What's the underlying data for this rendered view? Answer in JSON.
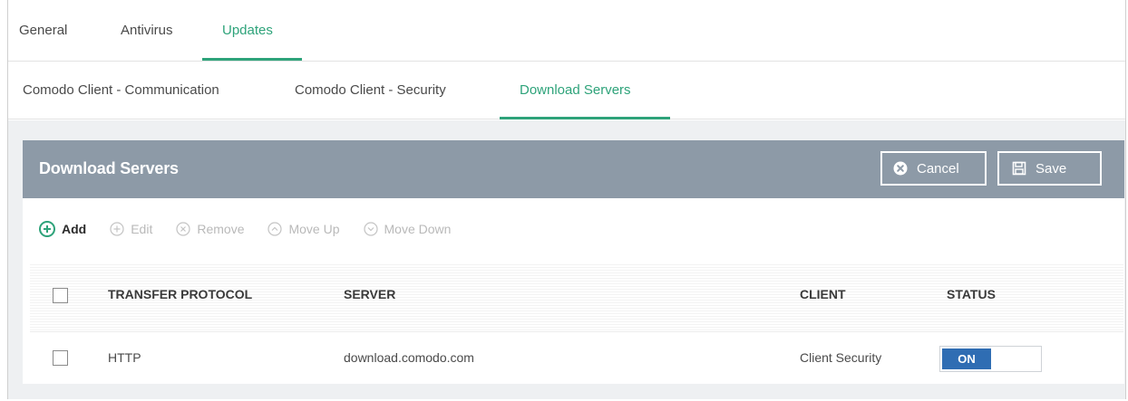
{
  "tabs_primary": [
    {
      "label": "General",
      "active": false
    },
    {
      "label": "Antivirus",
      "active": false
    },
    {
      "label": "Updates",
      "active": true
    }
  ],
  "tabs_secondary": [
    {
      "label": "Comodo Client - Communication",
      "active": false
    },
    {
      "label": "Comodo Client - Security",
      "active": false
    },
    {
      "label": "Download Servers",
      "active": true
    }
  ],
  "panel": {
    "title": "Download Servers",
    "cancel_label": "Cancel",
    "save_label": "Save",
    "cancel_icon": "close-circle-icon",
    "save_icon": "floppy-disk-icon"
  },
  "toolbar": {
    "items": [
      {
        "label": "Add",
        "icon": "plus-circle-icon",
        "enabled": true
      },
      {
        "label": "Edit",
        "icon": "plus-circle-icon",
        "enabled": false
      },
      {
        "label": "Remove",
        "icon": "x-circle-icon",
        "enabled": false
      },
      {
        "label": "Move Up",
        "icon": "chevron-up-circle-icon",
        "enabled": false
      },
      {
        "label": "Move Down",
        "icon": "chevron-down-circle-icon",
        "enabled": false
      }
    ]
  },
  "table": {
    "columns": [
      "TRANSFER PROTOCOL",
      "SERVER",
      "CLIENT",
      "STATUS"
    ],
    "rows": [
      {
        "protocol": "HTTP",
        "server": "download.comodo.com",
        "client": "Client Security",
        "status": "ON",
        "checked": false
      }
    ]
  },
  "colors": {
    "accent": "#2ea37a",
    "header_bg": "#8d9aa7",
    "toggle_on": "#2f6db3"
  }
}
